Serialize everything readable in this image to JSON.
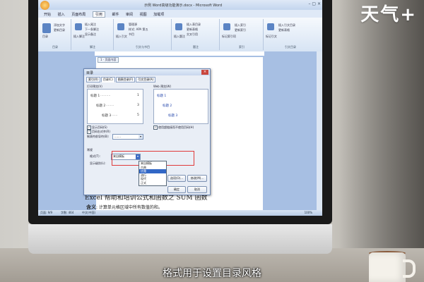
{
  "brand": "天气+",
  "subtitle": "格式用于设置目录风格",
  "window": {
    "title": "示例 Word高级功能演示.docx - Microsoft Word"
  },
  "menu": [
    "开始",
    "插入",
    "页面布局",
    "引用",
    "邮件",
    "审阅",
    "视图",
    "加载项"
  ],
  "menu_active_index": 3,
  "ribbon_groups": [
    {
      "label": "目录",
      "items": [
        "目录",
        "添加文字",
        "更新目录"
      ]
    },
    {
      "label": "脚注",
      "items": [
        "插入脚注",
        "插入尾注",
        "下一条脚注",
        "显示备注"
      ]
    },
    {
      "label": "引文与书目",
      "items": [
        "插入引文",
        "管理源",
        "样式: APA 第五",
        "书目"
      ]
    },
    {
      "label": "题注",
      "items": [
        "插入题注",
        "插入表目录",
        "更新表格",
        "交叉引用"
      ]
    },
    {
      "label": "索引",
      "items": [
        "标记索引项",
        "插入索引",
        "更新索引"
      ]
    },
    {
      "label": "引文目录",
      "items": [
        "标记引文",
        "插入引文目录",
        "更新表格"
      ]
    }
  ],
  "doc_tab": "1 · 页面内容",
  "dialog": {
    "title": "目录",
    "close": "×",
    "tabs": [
      "索引(X)",
      "目录(C)",
      "图表目录(F)",
      "引文目录(A)"
    ],
    "tabs_active_index": 1,
    "print_preview_label": "打印预览(V)",
    "print_preview_lines": [
      {
        "text": "标题 1",
        "page": "1",
        "indent": 0
      },
      {
        "text": "标题 2",
        "page": "3",
        "indent": 1
      },
      {
        "text": "标题 3",
        "page": "5",
        "indent": 2
      }
    ],
    "web_preview_label": "Web 预览(W)",
    "web_preview_lines": [
      "标题 1",
      "标题 2",
      "标题 3"
    ],
    "show_page_numbers": "显示页码(S)",
    "right_align": "页码右对齐(R)",
    "tab_leader_label": "制表符前导符(B):",
    "tab_leader_value": ".......",
    "use_hyperlinks": "使用超链接而不使用页码(H)",
    "general_label": "常规",
    "format_label": "格式(T):",
    "format_value": "来自模板",
    "show_levels_label": "显示级别(L):",
    "format_options": [
      "来自模板",
      "古典",
      "优雅",
      "流行",
      "现代",
      "正式"
    ],
    "format_selected_index": 2,
    "btn_options": "选项(O)...",
    "btn_modify": "修改(M)...",
    "btn_ok": "确定",
    "btn_cancel": "取消"
  },
  "doc_text": {
    "line1": "Excel 帮助和培训公式和函数之 SUM 函数",
    "line2_bold": "含义",
    "line2_rest": ": 计算单元格区域中所有数值的和。"
  },
  "status": {
    "page": "页面: 9/9",
    "words": "字数: 464",
    "lang": "中文(中国)",
    "zoom": "100%"
  },
  "colors": {
    "screen_bg": "#7ea3d6",
    "highlight": "#e03a3a",
    "selection": "#3267c6"
  }
}
